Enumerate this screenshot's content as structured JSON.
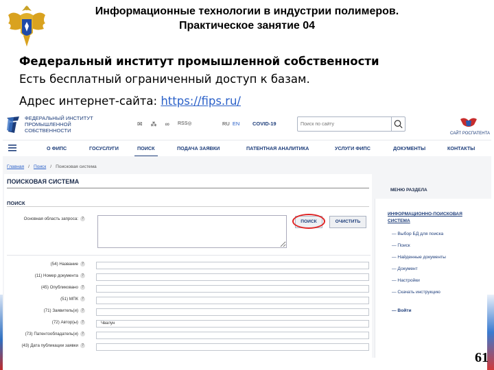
{
  "slide": {
    "title_line1": "Информационные технологии в индустрии полимеров.",
    "title_line2": "Практическое занятие 04",
    "org_title": "Федеральный институт промышленной собственности",
    "description": "Есть бесплатный ограниченный доступ к базам.",
    "address_label": "Адрес интернет-сайта:",
    "address_url": "https://fips.ru/",
    "page_number": "61"
  },
  "site": {
    "logo_text": "ФЕДЕРАЛЬНЫЙ ИНСТИТУТ ПРОМЫШЛЕННОЙ СОБСТВЕННОСТИ",
    "rss": "RSS",
    "lang_ru": "RU",
    "lang_en": "EN",
    "covid": "COVID-19",
    "search_placeholder": "Поиск по сайту",
    "rospatent": "САЙТ РОСПАТЕНТА",
    "nav": [
      "О ФИПС",
      "ГОСУСЛУГИ",
      "ПОИСК",
      "ПОДАЧА ЗАЯВКИ",
      "ПАТЕНТНАЯ АНАЛИТИКА",
      "УСЛУГИ ФИПС",
      "ДОКУМЕНТЫ",
      "КОНТАКТЫ"
    ],
    "breadcrumbs": [
      "Главная",
      "Поиск",
      "Поисковая система"
    ],
    "page_title": "ПОИСКОВАЯ СИСТЕМА",
    "section_title": "ПОИСК",
    "main_query_label": "Основная область запроса:",
    "search_button": "ПОИСК",
    "clear_button": "ОЧИСТИТЬ",
    "fields": [
      {
        "label": "(54) Название",
        "value": ""
      },
      {
        "label": "(11) Номер документа",
        "value": ""
      },
      {
        "label": "(45) Опубликовано",
        "value": ""
      },
      {
        "label": "(51) МПК",
        "value": ""
      },
      {
        "label": "(71) Заявитель(и)",
        "value": ""
      },
      {
        "label": "(72) Автор(ы)",
        "value": "Чвалун"
      },
      {
        "label": "(73) Патентообладатель(и)",
        "value": ""
      },
      {
        "label": "(43) Дата публикации заявки",
        "value": ""
      }
    ],
    "sidebar": {
      "heading": "МЕНЮ РАЗДЕЛА",
      "group": "ИНФОРМАЦИОННО-ПОИСКОВАЯ СИСТЕМА",
      "items": [
        "— Выбор БД для поиска",
        "— Поиск",
        "— Найденные документы",
        "— Документ",
        "— Настройки",
        "— Скачать инструкцию"
      ],
      "login": "— Войти"
    }
  },
  "colors": {
    "accent": "#1d3d7a",
    "link": "#2a60c8",
    "highlight": "#e02424"
  }
}
